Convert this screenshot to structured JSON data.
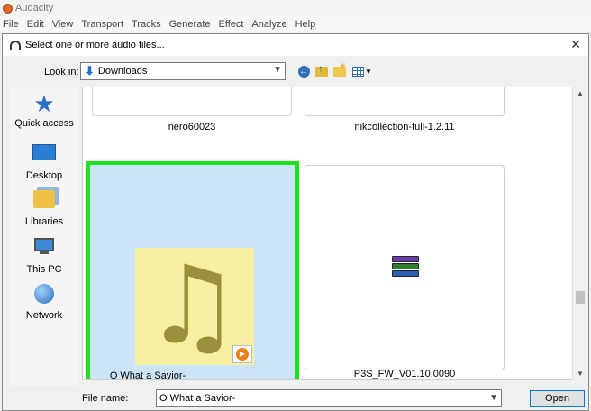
{
  "app": {
    "title": "Audacity"
  },
  "menu": [
    "File",
    "Edit",
    "View",
    "Transport",
    "Tracks",
    "Generate",
    "Effect",
    "Analyze",
    "Help"
  ],
  "dialog": {
    "title": "Select one or more audio files...",
    "close_icon": "close-icon",
    "look_in_label": "Look in:",
    "look_in_value": "Downloads",
    "toolbar_icons": [
      "back-icon",
      "up-folder-icon",
      "new-folder-icon",
      "view-menu-icon"
    ]
  },
  "places": [
    {
      "label": "Quick access",
      "icon": "star-icon"
    },
    {
      "label": "Desktop",
      "icon": "desktop-icon"
    },
    {
      "label": "Libraries",
      "icon": "libraries-icon"
    },
    {
      "label": "This PC",
      "icon": "computer-icon"
    },
    {
      "label": "Network",
      "icon": "network-icon"
    }
  ],
  "files": [
    {
      "name": "nero60023",
      "type": "folder"
    },
    {
      "name": "nikcollection-full-1.2.11",
      "type": "folder"
    },
    {
      "name": "O What a Savior-",
      "type": "audio",
      "selected": true
    },
    {
      "name": "P3S_FW_V01.10.0090",
      "type": "archive"
    }
  ],
  "footer": {
    "file_name_label": "File name:",
    "file_name_value": "O What a Savior-",
    "open_label": "Open"
  },
  "colors": {
    "selection_border": "#1be21b",
    "selection_fill": "#cce4f7"
  }
}
